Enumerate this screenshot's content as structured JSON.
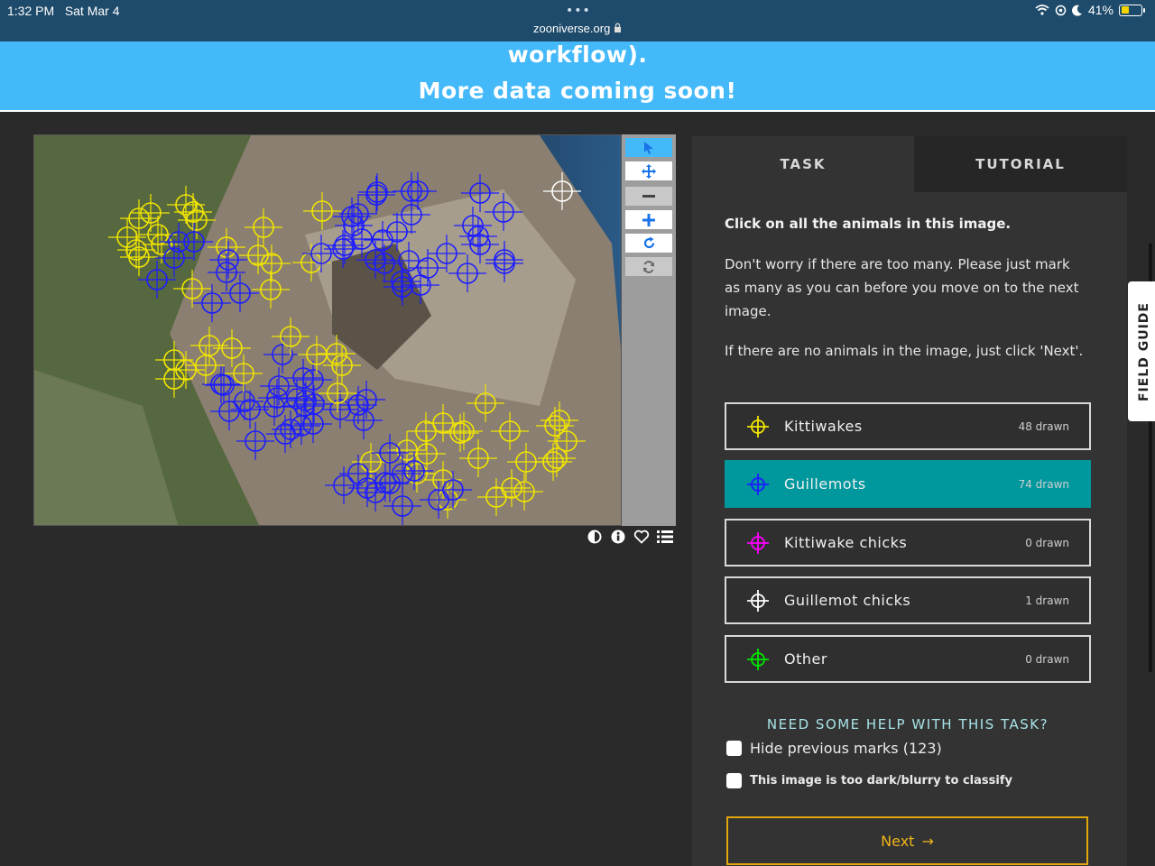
{
  "statusbar": {
    "time": "1:32 PM",
    "date": "Sat Mar 4",
    "dots": "•••",
    "url": "zooniverse.org",
    "battery": "41%",
    "battery_level": 0.41
  },
  "banner": {
    "line1": "workflow).",
    "line2": "More data coming soon!"
  },
  "toolbar": {
    "pointer": "pointer-icon",
    "move": "move-icon",
    "zoom_out": "minus-icon",
    "zoom_in": "plus-icon",
    "rotate": "rotate-icon",
    "reset": "reset-icon"
  },
  "viewer_icons": [
    "contrast-icon",
    "info-icon",
    "heart-icon",
    "list-icon"
  ],
  "tabs": {
    "task": "TASK",
    "tutorial": "TUTORIAL"
  },
  "task": {
    "question": "Click on all the animals in this image.",
    "para1": "Don't worry if there are too many. Please just mark as many as you can before you move on to the next image.",
    "para2": "If there are no animals in the image, just click 'Next'."
  },
  "options": [
    {
      "label": "Kittiwakes",
      "count": "48 drawn",
      "color": "#f2e600",
      "selected": false
    },
    {
      "label": "Guillemots",
      "count": "74 drawn",
      "color": "#1c1cff",
      "selected": true
    },
    {
      "label": "Kittiwake chicks",
      "count": "0 drawn",
      "color": "#ff00ff",
      "selected": false
    },
    {
      "label": "Guillemot chicks",
      "count": "1 drawn",
      "color": "#ffffff",
      "selected": false
    },
    {
      "label": "Other",
      "count": "0 drawn",
      "color": "#00e600",
      "selected": false
    }
  ],
  "help": {
    "link": "NEED SOME HELP WITH THIS TASK?",
    "hide_marks": "Hide previous marks (123)",
    "too_dark": "This image is too dark/blurry to classify"
  },
  "next": {
    "label": "Next",
    "arrow": "→"
  },
  "field_guide": "FIELD GUIDE"
}
